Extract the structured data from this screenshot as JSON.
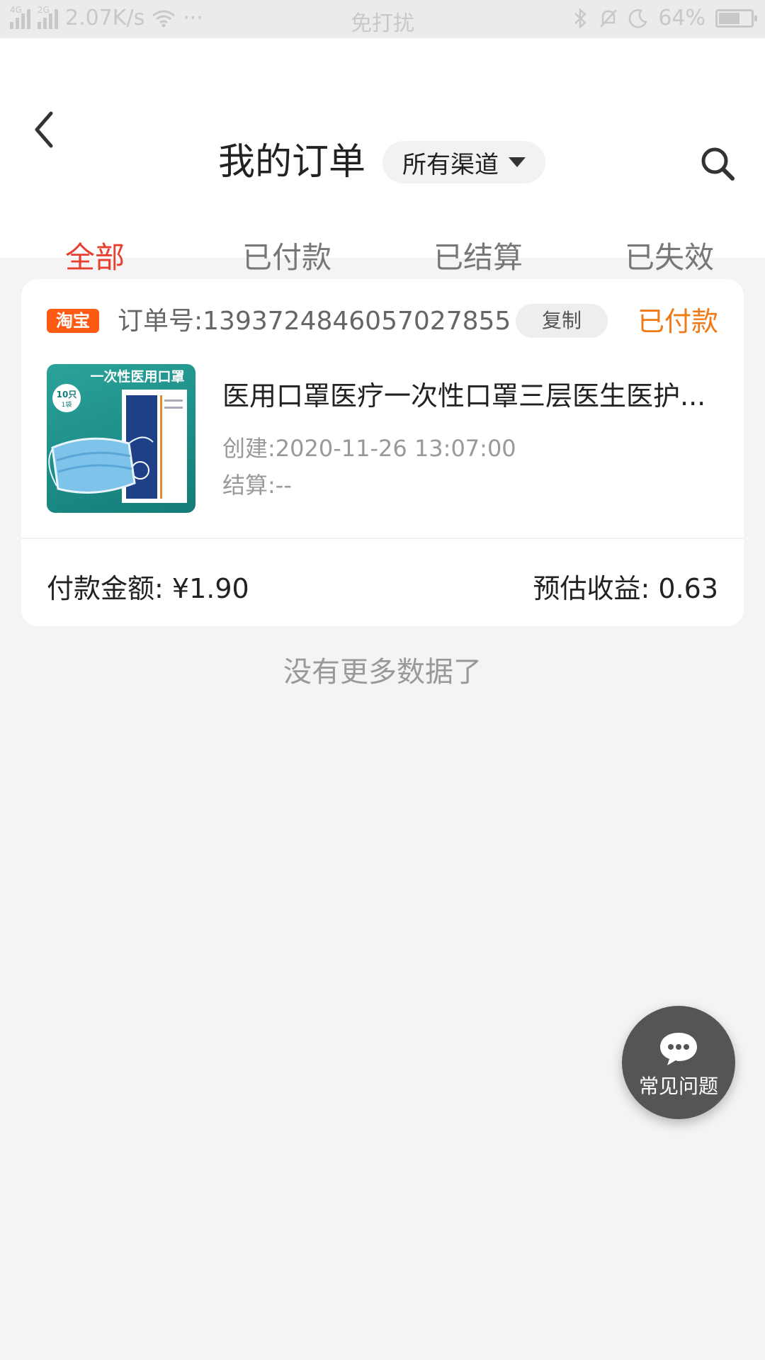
{
  "status_bar": {
    "network_1": "4G",
    "network_2": "2G",
    "speed": "2.07K/s",
    "more": "···",
    "center_text": "免打扰",
    "battery": "64%"
  },
  "header": {
    "title": "我的订单",
    "channel_filter": "所有渠道"
  },
  "tabs": [
    {
      "label": "全部",
      "active": true
    },
    {
      "label": "已付款",
      "active": false
    },
    {
      "label": "已结算",
      "active": false
    },
    {
      "label": "已失效",
      "active": false
    }
  ],
  "order": {
    "platform": "淘宝",
    "order_no_label": "订单号:",
    "order_no": "1393724846057027855",
    "copy_label": "复制",
    "status": "已付款",
    "product_image_text": "一次性医用口罩",
    "product_badge": "10只",
    "product_badge_sub": "1袋",
    "product_title": "医用口罩医疗一次性口罩三层医生医护...",
    "created_label": "创建:",
    "created": "2020-11-26 13:07:00",
    "settle_label": "结算:",
    "settle": "--",
    "pay_label": "付款金额:",
    "pay_amount": "¥1.90",
    "est_label": "预估收益:",
    "est_amount": "0.63"
  },
  "footer_text": "没有更多数据了",
  "faq_button": "常见问题",
  "colors": {
    "accent": "#e8402e",
    "status_orange": "#f07a17",
    "taobao": "#ff5a14"
  }
}
